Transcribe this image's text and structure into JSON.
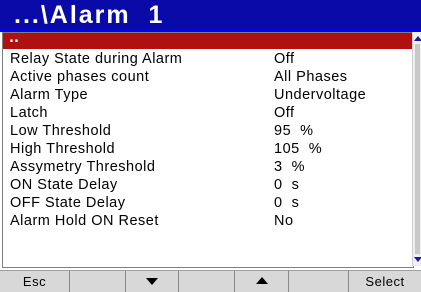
{
  "header": {
    "title": "...\\Alarm  1"
  },
  "list": {
    "selected_label": "..",
    "rows": [
      {
        "label": "Relay State during Alarm",
        "value": "Off"
      },
      {
        "label": "Active phases count",
        "value": "All Phases"
      },
      {
        "label": "Alarm Type",
        "value": "Undervoltage"
      },
      {
        "label": "Latch",
        "value": "Off"
      },
      {
        "label": "Low Threshold",
        "value": "95  %"
      },
      {
        "label": "High Threshold",
        "value": "105  %"
      },
      {
        "label": "Assymetry Threshold",
        "value": "3  %"
      },
      {
        "label": "ON State Delay",
        "value": "0  s"
      },
      {
        "label": "OFF State Delay",
        "value": "0  s"
      },
      {
        "label": "Alarm Hold ON Reset",
        "value": "No"
      }
    ]
  },
  "softkeys": {
    "esc": "Esc",
    "select": "Select",
    "down_icon": "arrow-down-icon",
    "up_icon": "arrow-up-icon"
  },
  "colors": {
    "title_bar": "#0a0aa8",
    "selected_row": "#b01010",
    "softkey_bar": "#d8d8d8"
  }
}
